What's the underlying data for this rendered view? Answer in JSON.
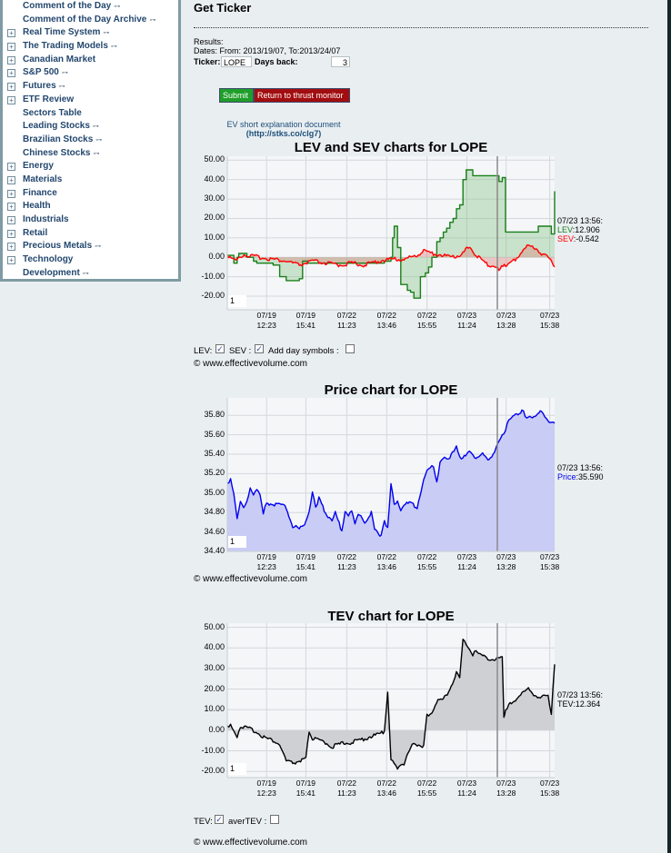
{
  "sidebar": {
    "items": [
      {
        "label": "Comment of the Day",
        "expandable": false,
        "key": true
      },
      {
        "label": "Comment of the Day Archive",
        "expandable": false,
        "key": true
      },
      {
        "label": "Real Time System",
        "expandable": true,
        "key": true
      },
      {
        "label": "The Trading Models",
        "expandable": true,
        "key": true
      },
      {
        "label": "Canadian Market",
        "expandable": true,
        "key": false
      },
      {
        "label": "S&P 500",
        "expandable": true,
        "key": true
      },
      {
        "label": "Futures",
        "expandable": true,
        "key": true
      },
      {
        "label": "ETF Review",
        "expandable": true,
        "key": false
      },
      {
        "label": "Sectors Table",
        "expandable": false,
        "key": false
      },
      {
        "label": "Leading Stocks",
        "expandable": false,
        "key": true
      },
      {
        "label": "Brazilian Stocks",
        "expandable": false,
        "key": true
      },
      {
        "label": "Chinese Stocks",
        "expandable": false,
        "key": true
      },
      {
        "label": "Energy",
        "expandable": true,
        "key": false
      },
      {
        "label": "Materials",
        "expandable": true,
        "key": false
      },
      {
        "label": "Finance",
        "expandable": true,
        "key": false
      },
      {
        "label": "Health",
        "expandable": true,
        "key": false
      },
      {
        "label": "Industrials",
        "expandable": true,
        "key": false
      },
      {
        "label": "Retail",
        "expandable": true,
        "key": false
      },
      {
        "label": "Precious Metals",
        "expandable": true,
        "key": true
      },
      {
        "label": "Technology",
        "expandable": true,
        "key": false
      },
      {
        "label": "Development",
        "expandable": false,
        "key": true
      }
    ],
    "plus_glyph": "+",
    "key_glyph": "⊶"
  },
  "page": {
    "title": "Get Ticker",
    "results_label": "Results:",
    "dates_text": "Dates: From: 2013/19/07, To:2013/24/07",
    "ticker_label": "Ticker:",
    "ticker_value": "LOPE",
    "days_back_label": "Days back:",
    "days_back_value": "3",
    "submit_label": "Submit",
    "return_label": "Return to thrust monitor",
    "ev_doc_label": "EV short explanation document",
    "ev_doc_link": "(http://stks.co/clg7)",
    "copyright": "© www.effectivevolume.com"
  },
  "colors": {
    "lev": "#1a7f1a",
    "sev": "#ff0000",
    "price": "#0000ee",
    "tev": "#000000",
    "button_submit": "#1f9e2a",
    "button_return": "#a20d10"
  },
  "chart_data": [
    {
      "type": "line",
      "title": "LEV and SEV charts for LOPE",
      "ylim": [
        -27,
        52
      ],
      "yticks": [
        "50.00",
        "40.00",
        "30.00",
        "20.00",
        "10.00",
        "0.00",
        "-10.00",
        "-20.00"
      ],
      "ytick_values": [
        50,
        40,
        30,
        20,
        10,
        0,
        -10,
        -20
      ],
      "xticks": [
        [
          "07/19",
          "12:23"
        ],
        [
          "07/19",
          "15:41"
        ],
        [
          "07/22",
          "11:23"
        ],
        [
          "07/22",
          "13:46"
        ],
        [
          "07/22",
          "15:55"
        ],
        [
          "07/23",
          "11:24"
        ],
        [
          "07/23",
          "13:28"
        ],
        [
          "07/23",
          "15:38"
        ]
      ],
      "xtick_positions": [
        0.12,
        0.24,
        0.365,
        0.487,
        0.61,
        0.732,
        0.852,
        0.985
      ],
      "cursor_position": 0.825,
      "zoom_value": "1",
      "grid": true,
      "readout": {
        "time": "07/23 13:56:",
        "lev_label": "LEV",
        "lev_value": "12.906",
        "sev_label": "SEV",
        "sev_value": "-0.542"
      },
      "series": [
        {
          "name": "LEV",
          "step": true,
          "x": [
            0,
            0.02,
            0.03,
            0.035,
            0.045,
            0.06,
            0.08,
            0.09,
            0.12,
            0.14,
            0.16,
            0.18,
            0.2,
            0.22,
            0.23,
            0.245,
            0.25,
            0.3,
            0.33,
            0.36,
            0.4,
            0.45,
            0.48,
            0.5,
            0.505,
            0.51,
            0.52,
            0.53,
            0.55,
            0.56,
            0.57,
            0.57,
            0.59,
            0.6,
            0.605,
            0.615,
            0.625,
            0.64,
            0.65,
            0.66,
            0.67,
            0.68,
            0.69,
            0.7,
            0.71,
            0.72,
            0.73,
            0.74,
            0.75,
            0.76,
            0.765,
            0.78,
            0.8,
            0.82,
            0.83,
            0.84,
            0.845,
            0.85,
            0.86,
            0.87,
            0.9,
            0.94,
            0.95,
            0.97,
            0.98,
            0.99,
            1.0
          ],
          "y": [
            1,
            -3,
            0,
            2,
            2,
            0,
            -2,
            -3,
            -3,
            -4,
            -10,
            -12,
            -12,
            -11,
            -2,
            -3,
            -3,
            -3,
            -3,
            -3,
            -3,
            -3,
            -2,
            0,
            10,
            16,
            5,
            -14,
            -17,
            -18,
            -20,
            -21,
            -10,
            -10,
            -8,
            -5,
            0,
            8,
            10,
            13,
            15,
            18,
            20,
            25,
            27,
            40,
            45,
            45,
            42,
            42,
            42,
            42,
            42,
            42,
            39,
            41,
            41,
            13,
            13,
            13,
            13,
            13,
            16,
            16,
            16,
            12,
            34
          ]
        },
        {
          "name": "SEV",
          "step": false,
          "x": [
            0,
            0.03,
            0.06,
            0.1,
            0.14,
            0.18,
            0.22,
            0.26,
            0.3,
            0.34,
            0.38,
            0.42,
            0.46,
            0.5,
            0.54,
            0.58,
            0.6,
            0.63,
            0.66,
            0.69,
            0.72,
            0.74,
            0.76,
            0.78,
            0.8,
            0.83,
            0.85,
            0.88,
            0.9,
            0.92,
            0.94,
            0.96,
            0.98,
            1.0
          ],
          "y": [
            1,
            -1,
            1,
            0,
            -1,
            -2,
            -4,
            -2,
            -3,
            -4,
            -3,
            -4,
            -2,
            -1,
            -1,
            1,
            3,
            2,
            1,
            0,
            2,
            6,
            1,
            -2,
            -4,
            -6,
            -4,
            -1,
            3,
            6,
            5,
            2,
            0,
            -5
          ]
        }
      ]
    },
    {
      "type": "area",
      "title": "Price chart for LOPE",
      "ylim": [
        34.4,
        35.98
      ],
      "yticks": [
        "35.80",
        "35.60",
        "35.40",
        "35.20",
        "35.00",
        "34.80",
        "34.60",
        "34.40"
      ],
      "ytick_values": [
        35.8,
        35.6,
        35.4,
        35.2,
        35.0,
        34.8,
        34.6,
        34.4
      ],
      "xticks": [
        [
          "07/19",
          "12:23"
        ],
        [
          "07/19",
          "15:41"
        ],
        [
          "07/22",
          "11:23"
        ],
        [
          "07/22",
          "13:46"
        ],
        [
          "07/22",
          "15:55"
        ],
        [
          "07/23",
          "11:24"
        ],
        [
          "07/23",
          "13:28"
        ],
        [
          "07/23",
          "15:38"
        ]
      ],
      "xtick_positions": [
        0.12,
        0.24,
        0.365,
        0.487,
        0.61,
        0.732,
        0.852,
        0.985
      ],
      "cursor_position": 0.825,
      "zoom_value": "1",
      "grid": true,
      "readout": {
        "time": "07/23 13:56:",
        "price_label": "Price",
        "price_value": "35.590"
      },
      "series": [
        {
          "name": "Price",
          "x": [
            0,
            0.01,
            0.02,
            0.03,
            0.04,
            0.05,
            0.06,
            0.07,
            0.08,
            0.09,
            0.1,
            0.11,
            0.12,
            0.14,
            0.16,
            0.18,
            0.2,
            0.21,
            0.22,
            0.24,
            0.25,
            0.26,
            0.27,
            0.28,
            0.3,
            0.32,
            0.33,
            0.35,
            0.36,
            0.37,
            0.38,
            0.39,
            0.4,
            0.42,
            0.44,
            0.45,
            0.47,
            0.48,
            0.49,
            0.5,
            0.51,
            0.52,
            0.53,
            0.54,
            0.56,
            0.58,
            0.6,
            0.61,
            0.62,
            0.63,
            0.64,
            0.65,
            0.66,
            0.68,
            0.7,
            0.71,
            0.72,
            0.74,
            0.76,
            0.78,
            0.8,
            0.82,
            0.84,
            0.85,
            0.86,
            0.88,
            0.9,
            0.91,
            0.92,
            0.94,
            0.96,
            0.97,
            0.98,
            1.0
          ],
          "y": [
            35.1,
            35.15,
            35.0,
            34.75,
            34.9,
            34.85,
            34.9,
            35.05,
            35.0,
            35.05,
            35.0,
            34.8,
            34.9,
            34.88,
            34.88,
            34.85,
            34.65,
            34.67,
            34.65,
            34.7,
            34.8,
            35.0,
            34.85,
            34.95,
            34.8,
            34.72,
            34.8,
            34.6,
            34.8,
            34.75,
            34.82,
            34.7,
            34.78,
            34.7,
            34.8,
            34.62,
            34.55,
            34.7,
            34.65,
            35.1,
            34.9,
            34.9,
            34.8,
            34.88,
            34.9,
            34.85,
            35.15,
            35.25,
            35.28,
            35.25,
            35.1,
            35.3,
            35.35,
            35.35,
            35.5,
            35.38,
            35.35,
            35.45,
            35.35,
            35.4,
            35.35,
            35.45,
            35.6,
            35.65,
            35.75,
            35.8,
            35.85,
            35.8,
            35.78,
            35.8,
            35.85,
            35.78,
            35.75,
            35.72
          ]
        }
      ]
    },
    {
      "type": "area",
      "title": "TEV chart for LOPE",
      "ylim": [
        -23,
        52
      ],
      "yticks": [
        "50.00",
        "40.00",
        "30.00",
        "20.00",
        "10.00",
        "0.00",
        "-10.00",
        "-20.00"
      ],
      "ytick_values": [
        50,
        40,
        30,
        20,
        10,
        0,
        -10,
        -20
      ],
      "xticks": [
        [
          "07/19",
          "12:23"
        ],
        [
          "07/19",
          "15:41"
        ],
        [
          "07/22",
          "11:23"
        ],
        [
          "07/22",
          "13:46"
        ],
        [
          "07/22",
          "15:55"
        ],
        [
          "07/23",
          "11:24"
        ],
        [
          "07/23",
          "13:28"
        ],
        [
          "07/23",
          "15:38"
        ]
      ],
      "xtick_positions": [
        0.12,
        0.24,
        0.365,
        0.487,
        0.61,
        0.732,
        0.852,
        0.985
      ],
      "cursor_position": 0.825,
      "zoom_value": "1",
      "grid": true,
      "readout": {
        "time": "07/23 13:56:",
        "tev_label": "TEV",
        "tev_value": "12.364"
      },
      "series": [
        {
          "name": "TEV",
          "x": [
            0,
            0.01,
            0.02,
            0.03,
            0.04,
            0.06,
            0.08,
            0.1,
            0.12,
            0.14,
            0.16,
            0.18,
            0.2,
            0.22,
            0.24,
            0.25,
            0.26,
            0.28,
            0.3,
            0.32,
            0.34,
            0.36,
            0.38,
            0.4,
            0.42,
            0.44,
            0.46,
            0.48,
            0.49,
            0.5,
            0.51,
            0.52,
            0.54,
            0.56,
            0.57,
            0.58,
            0.6,
            0.61,
            0.62,
            0.63,
            0.64,
            0.66,
            0.68,
            0.7,
            0.71,
            0.72,
            0.73,
            0.74,
            0.75,
            0.76,
            0.78,
            0.8,
            0.82,
            0.84,
            0.845,
            0.85,
            0.86,
            0.88,
            0.9,
            0.92,
            0.94,
            0.96,
            0.98,
            0.99,
            1.0
          ],
          "y": [
            2,
            3,
            0,
            -3,
            2,
            1,
            0,
            -2,
            -4,
            -5,
            -7,
            -15,
            -16,
            -15,
            -14,
            0,
            -4,
            -5,
            -6,
            -8,
            -7,
            -6,
            -6,
            -5,
            -4,
            -3,
            -2,
            -1,
            18,
            -15,
            -16,
            -18,
            -17,
            -8,
            -7,
            -8,
            -8,
            7,
            8,
            10,
            14,
            15,
            20,
            28,
            25,
            45,
            42,
            40,
            37,
            38,
            36,
            35,
            34,
            36,
            7,
            10,
            12,
            15,
            18,
            20,
            17,
            16,
            17,
            8,
            32
          ]
        }
      ]
    }
  ],
  "controls": {
    "lev_label": "LEV:",
    "lev_checked": true,
    "sev_label": "SEV :",
    "sev_checked": true,
    "day_symbols_label": "Add day symbols :",
    "day_symbols_checked": false,
    "tev_label": "TEV:",
    "tev_checked": true,
    "avertev_label": "averTEV :",
    "avertev_checked": false,
    "check_glyph": "✓"
  }
}
